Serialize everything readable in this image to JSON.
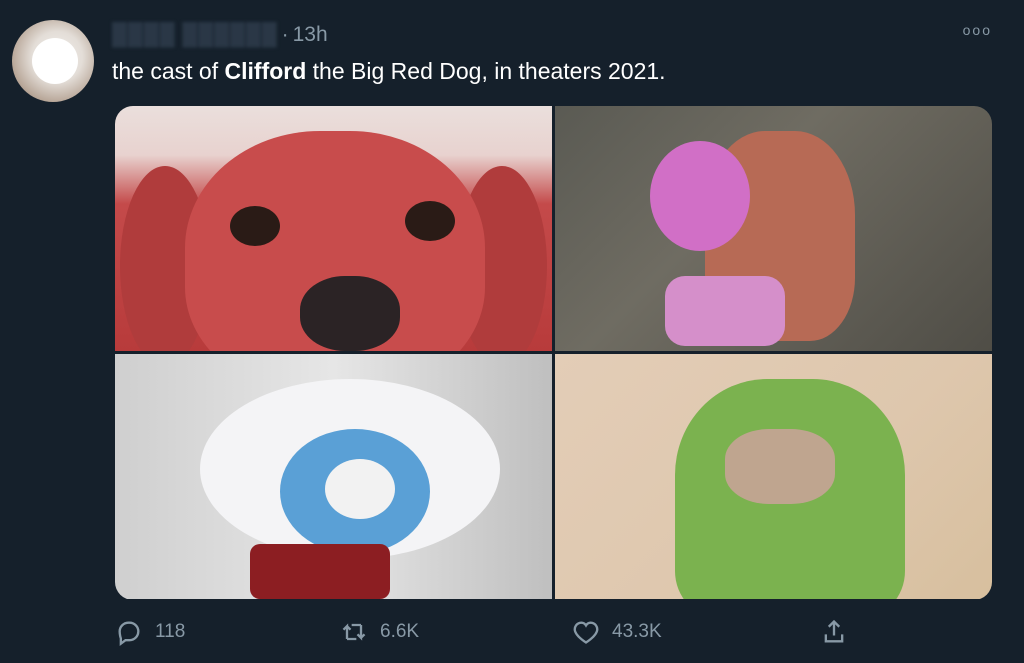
{
  "tweet": {
    "author_handle": "████ ██████",
    "separator": "·",
    "timestamp": "13h",
    "text_before": "the cast of ",
    "text_bold": "Clifford",
    "text_after": " the Big Red Dog, in theaters 2021.",
    "more_label": "ooo"
  },
  "media": {
    "photos": [
      {
        "icon": "red-dog-photo"
      },
      {
        "icon": "pink-pomeranian-photo"
      },
      {
        "icon": "blue-faced-white-dog-photo"
      },
      {
        "icon": "green-dog-photo"
      }
    ]
  },
  "actions": {
    "reply_count": "118",
    "retweet_count": "6.6K",
    "like_count": "43.3K"
  },
  "colors": {
    "background": "#15202b",
    "muted": "#8899a6",
    "text": "#ffffff"
  }
}
